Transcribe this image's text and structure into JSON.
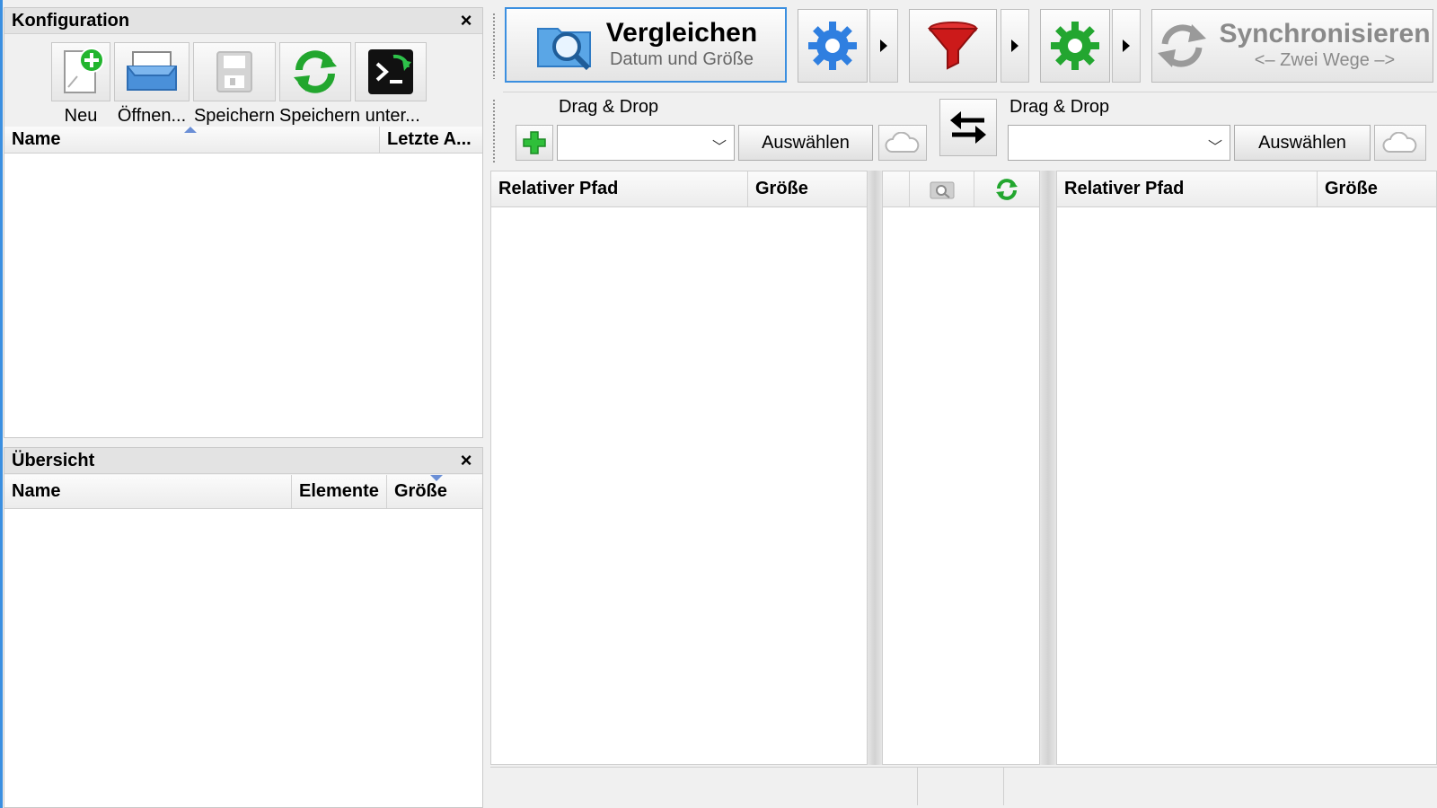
{
  "config_panel": {
    "title": "Konfiguration",
    "close": "×",
    "toolbar": {
      "new": "Neu",
      "open": "Öffnen...",
      "save": "Speichern",
      "save_as": "Speichern unter...",
      "batch": ""
    },
    "columns": {
      "name": "Name",
      "last": "Letzte A..."
    }
  },
  "overview_panel": {
    "title": "Übersicht",
    "close": "×",
    "columns": {
      "name": "Name",
      "items": "Elemente",
      "size": "Größe"
    }
  },
  "main_toolbar": {
    "compare_title": "Vergleichen",
    "compare_subtitle": "Datum und Größe",
    "sync_title": "Synchronisieren",
    "sync_subtitle": "<– Zwei Wege –>"
  },
  "folders": {
    "left": {
      "label": "Drag & Drop",
      "value": "",
      "select": "Auswählen"
    },
    "right": {
      "label": "Drag & Drop",
      "value": "",
      "select": "Auswählen"
    }
  },
  "grid": {
    "left": {
      "path": "Relativer Pfad",
      "size": "Größe"
    },
    "right": {
      "path": "Relativer Pfad",
      "size": "Größe"
    }
  },
  "status": {
    "left": "",
    "middle": "",
    "right": ""
  }
}
